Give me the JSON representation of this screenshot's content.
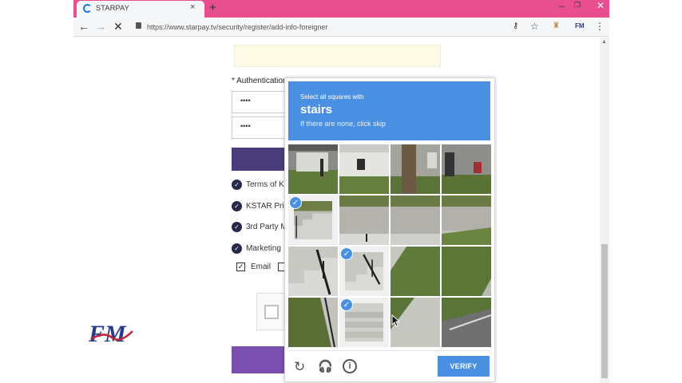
{
  "browser": {
    "tab_title": "STARPAY",
    "tab_close": "×",
    "new_tab": "+",
    "url": "https://www.starpay.tv/security/register/add-info-foreigner",
    "window_controls": {
      "minimize": "–",
      "maximize": "❐",
      "close": "✕"
    },
    "nav": {
      "back": "←",
      "forward": "→",
      "stop": "✕"
    },
    "toolbar_icons": {
      "key": "⚷",
      "star": "☆",
      "extension": "♜",
      "fm_ext": "FM",
      "menu": "⋮"
    },
    "tab_bar_color": "#e94e8f"
  },
  "page": {
    "auth_label": "* Authentication",
    "password_mask_1": "••••",
    "password_mask_2": "••••",
    "agreements": [
      {
        "label": "Terms of K"
      },
      {
        "label": "KSTAR Priv"
      },
      {
        "label": "3rd Party M"
      },
      {
        "label": "Marketing"
      }
    ],
    "agree_check": "✓",
    "email_label": "Email",
    "email_check": "✓",
    "brand_colors": {
      "primary": "#4a3b7a",
      "secondary": "#7a4fb0"
    }
  },
  "watermark": {
    "text": "FM"
  },
  "captcha": {
    "lead": "Select all squares with",
    "keyword": "stairs",
    "sub": "If there are none, click skip",
    "verify_label": "VERIFY",
    "icons": {
      "reload": "↻",
      "audio": "🎧",
      "info": "i"
    },
    "check": "✓",
    "accent": "#4a90e2",
    "tiles": [
      {
        "selected": false
      },
      {
        "selected": false
      },
      {
        "selected": false
      },
      {
        "selected": false
      },
      {
        "selected": true
      },
      {
        "selected": false
      },
      {
        "selected": false
      },
      {
        "selected": false
      },
      {
        "selected": false
      },
      {
        "selected": true
      },
      {
        "selected": false
      },
      {
        "selected": false
      },
      {
        "selected": false
      },
      {
        "selected": true
      },
      {
        "selected": false
      },
      {
        "selected": false
      }
    ]
  }
}
